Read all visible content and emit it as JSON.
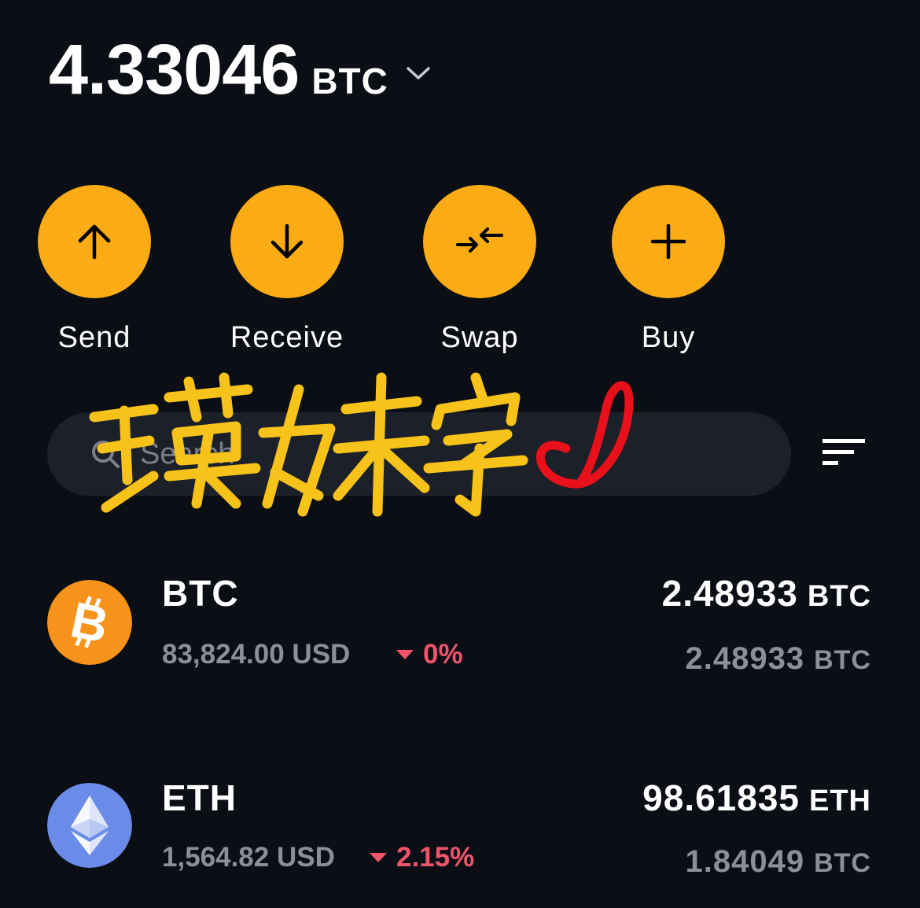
{
  "balance": {
    "amount": "4.33046",
    "unit": "BTC"
  },
  "actions": [
    {
      "label": "Send",
      "icon": "arrow-up-icon"
    },
    {
      "label": "Receive",
      "icon": "arrow-down-icon"
    },
    {
      "label": "Swap",
      "icon": "swap-arrows-icon"
    },
    {
      "label": "Buy",
      "icon": "plus-icon"
    }
  ],
  "search": {
    "placeholder": "Search"
  },
  "sort": {
    "icon": "sort-lines-icon"
  },
  "overlay": {
    "text": "璞妹宇"
  },
  "assets": [
    {
      "symbol": "BTC",
      "price": "83,824.00 USD",
      "change": "0%",
      "balance_amount": "2.48933",
      "balance_unit": "BTC",
      "fiat_amount": "2.48933",
      "fiat_unit": "BTC",
      "logo_color": "#f7931a",
      "icon": "bitcoin-icon"
    },
    {
      "symbol": "ETH",
      "price": "1,564.82 USD",
      "change": "2.15%",
      "balance_amount": "98.61835",
      "balance_unit": "ETH",
      "fiat_amount": "1.84049",
      "fiat_unit": "BTC",
      "logo_color": "#6a8be8",
      "icon": "ethereum-icon"
    }
  ],
  "colors": {
    "background": "#0b0e14",
    "accent": "#fbac14",
    "negative": "#f0546a",
    "muted_text": "#8b8f98"
  }
}
